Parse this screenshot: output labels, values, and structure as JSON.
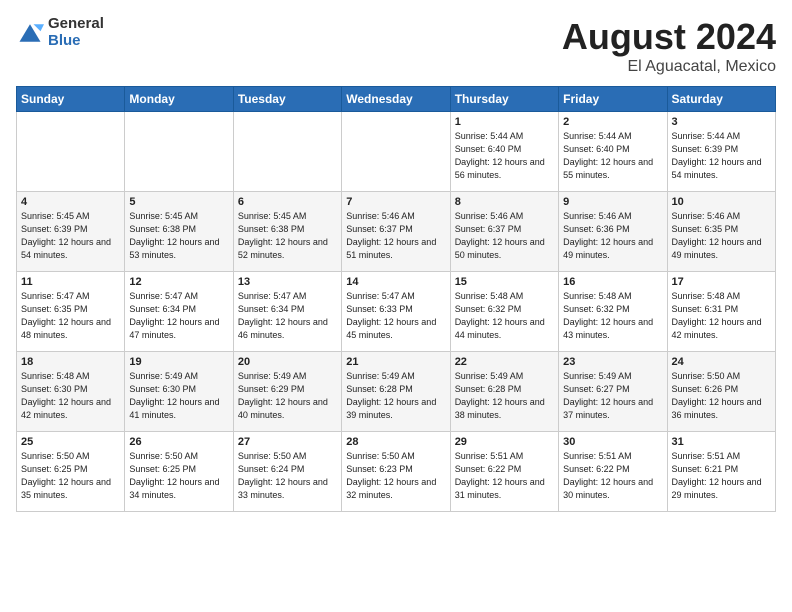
{
  "header": {
    "logo_general": "General",
    "logo_blue": "Blue",
    "month_title": "August 2024",
    "location": "El Aguacatal, Mexico"
  },
  "days_of_week": [
    "Sunday",
    "Monday",
    "Tuesday",
    "Wednesday",
    "Thursday",
    "Friday",
    "Saturday"
  ],
  "weeks": [
    [
      {
        "day": "",
        "info": ""
      },
      {
        "day": "",
        "info": ""
      },
      {
        "day": "",
        "info": ""
      },
      {
        "day": "",
        "info": ""
      },
      {
        "day": "1",
        "info": "Sunrise: 5:44 AM\nSunset: 6:40 PM\nDaylight: 12 hours\nand 56 minutes."
      },
      {
        "day": "2",
        "info": "Sunrise: 5:44 AM\nSunset: 6:40 PM\nDaylight: 12 hours\nand 55 minutes."
      },
      {
        "day": "3",
        "info": "Sunrise: 5:44 AM\nSunset: 6:39 PM\nDaylight: 12 hours\nand 54 minutes."
      }
    ],
    [
      {
        "day": "4",
        "info": "Sunrise: 5:45 AM\nSunset: 6:39 PM\nDaylight: 12 hours\nand 54 minutes."
      },
      {
        "day": "5",
        "info": "Sunrise: 5:45 AM\nSunset: 6:38 PM\nDaylight: 12 hours\nand 53 minutes."
      },
      {
        "day": "6",
        "info": "Sunrise: 5:45 AM\nSunset: 6:38 PM\nDaylight: 12 hours\nand 52 minutes."
      },
      {
        "day": "7",
        "info": "Sunrise: 5:46 AM\nSunset: 6:37 PM\nDaylight: 12 hours\nand 51 minutes."
      },
      {
        "day": "8",
        "info": "Sunrise: 5:46 AM\nSunset: 6:37 PM\nDaylight: 12 hours\nand 50 minutes."
      },
      {
        "day": "9",
        "info": "Sunrise: 5:46 AM\nSunset: 6:36 PM\nDaylight: 12 hours\nand 49 minutes."
      },
      {
        "day": "10",
        "info": "Sunrise: 5:46 AM\nSunset: 6:35 PM\nDaylight: 12 hours\nand 49 minutes."
      }
    ],
    [
      {
        "day": "11",
        "info": "Sunrise: 5:47 AM\nSunset: 6:35 PM\nDaylight: 12 hours\nand 48 minutes."
      },
      {
        "day": "12",
        "info": "Sunrise: 5:47 AM\nSunset: 6:34 PM\nDaylight: 12 hours\nand 47 minutes."
      },
      {
        "day": "13",
        "info": "Sunrise: 5:47 AM\nSunset: 6:34 PM\nDaylight: 12 hours\nand 46 minutes."
      },
      {
        "day": "14",
        "info": "Sunrise: 5:47 AM\nSunset: 6:33 PM\nDaylight: 12 hours\nand 45 minutes."
      },
      {
        "day": "15",
        "info": "Sunrise: 5:48 AM\nSunset: 6:32 PM\nDaylight: 12 hours\nand 44 minutes."
      },
      {
        "day": "16",
        "info": "Sunrise: 5:48 AM\nSunset: 6:32 PM\nDaylight: 12 hours\nand 43 minutes."
      },
      {
        "day": "17",
        "info": "Sunrise: 5:48 AM\nSunset: 6:31 PM\nDaylight: 12 hours\nand 42 minutes."
      }
    ],
    [
      {
        "day": "18",
        "info": "Sunrise: 5:48 AM\nSunset: 6:30 PM\nDaylight: 12 hours\nand 42 minutes."
      },
      {
        "day": "19",
        "info": "Sunrise: 5:49 AM\nSunset: 6:30 PM\nDaylight: 12 hours\nand 41 minutes."
      },
      {
        "day": "20",
        "info": "Sunrise: 5:49 AM\nSunset: 6:29 PM\nDaylight: 12 hours\nand 40 minutes."
      },
      {
        "day": "21",
        "info": "Sunrise: 5:49 AM\nSunset: 6:28 PM\nDaylight: 12 hours\nand 39 minutes."
      },
      {
        "day": "22",
        "info": "Sunrise: 5:49 AM\nSunset: 6:28 PM\nDaylight: 12 hours\nand 38 minutes."
      },
      {
        "day": "23",
        "info": "Sunrise: 5:49 AM\nSunset: 6:27 PM\nDaylight: 12 hours\nand 37 minutes."
      },
      {
        "day": "24",
        "info": "Sunrise: 5:50 AM\nSunset: 6:26 PM\nDaylight: 12 hours\nand 36 minutes."
      }
    ],
    [
      {
        "day": "25",
        "info": "Sunrise: 5:50 AM\nSunset: 6:25 PM\nDaylight: 12 hours\nand 35 minutes."
      },
      {
        "day": "26",
        "info": "Sunrise: 5:50 AM\nSunset: 6:25 PM\nDaylight: 12 hours\nand 34 minutes."
      },
      {
        "day": "27",
        "info": "Sunrise: 5:50 AM\nSunset: 6:24 PM\nDaylight: 12 hours\nand 33 minutes."
      },
      {
        "day": "28",
        "info": "Sunrise: 5:50 AM\nSunset: 6:23 PM\nDaylight: 12 hours\nand 32 minutes."
      },
      {
        "day": "29",
        "info": "Sunrise: 5:51 AM\nSunset: 6:22 PM\nDaylight: 12 hours\nand 31 minutes."
      },
      {
        "day": "30",
        "info": "Sunrise: 5:51 AM\nSunset: 6:22 PM\nDaylight: 12 hours\nand 30 minutes."
      },
      {
        "day": "31",
        "info": "Sunrise: 5:51 AM\nSunset: 6:21 PM\nDaylight: 12 hours\nand 29 minutes."
      }
    ]
  ]
}
